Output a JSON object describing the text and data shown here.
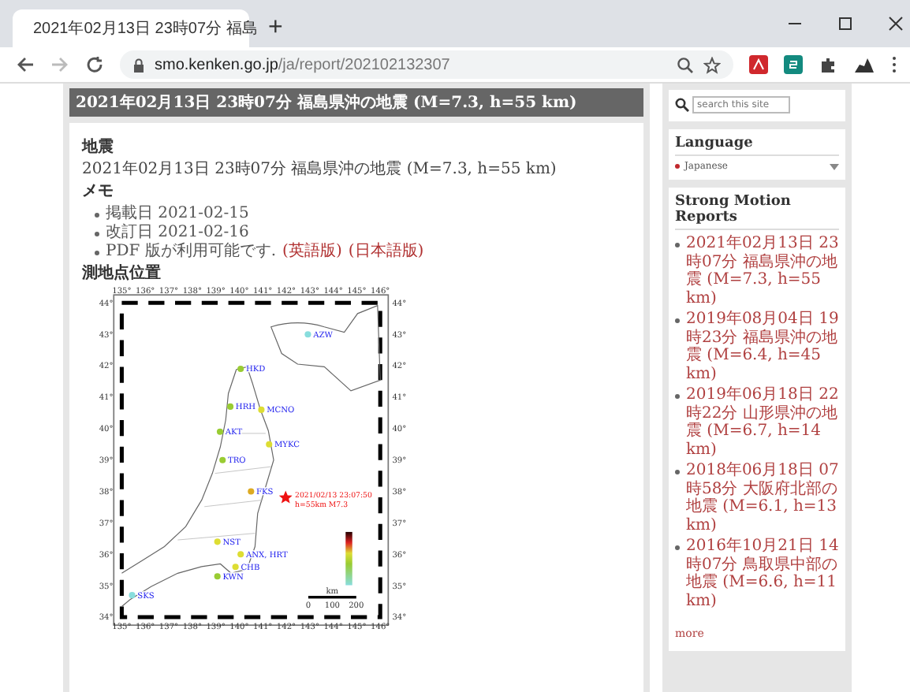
{
  "browser": {
    "tab_title": "2021年02月13日 23時07分 福島",
    "new_tab": "+",
    "url_host": "smo.kenken.go.jp",
    "url_path": "/ja/report/202102132307"
  },
  "page": {
    "heading": "2021年02月13日 23時07分 福島県沖の地震 (M=7.3, h=55 km)",
    "sections": [
      {
        "title": "地震",
        "text": "2021年02月13日 23時07分 福島県沖の地震 (M=7.3, h=55 km)"
      },
      {
        "title": "メモ",
        "items": [
          {
            "text": "掲載日 2021-02-15"
          },
          {
            "text": "改訂日 2021-02-16"
          },
          {
            "text": "PDF 版が利用可能です.",
            "links": [
              "(英語版)",
              "(日本語版)"
            ]
          }
        ]
      },
      {
        "title": "測地点位置"
      }
    ],
    "map": {
      "lon_ticks": [
        "135°",
        "136°",
        "137°",
        "138°",
        "139°",
        "140°",
        "141°",
        "142°",
        "143°",
        "144°",
        "145°",
        "146°"
      ],
      "lat_ticks": [
        "44°",
        "43°",
        "42°",
        "41°",
        "40°",
        "39°",
        "38°",
        "37°",
        "36°",
        "35°",
        "34°"
      ],
      "lat_ticks_right": [
        "44°",
        "43°",
        "42°",
        "41°",
        "40°",
        "39°",
        "38°",
        "37°",
        "36°",
        "35°",
        "34°"
      ],
      "lon_ticks_bottom": [
        "135°",
        "136°",
        "137°",
        "138°",
        "139°",
        "140°",
        "141°",
        "142°",
        "143°",
        "144°",
        "145°",
        "146°"
      ],
      "stations": [
        {
          "code": "AZW",
          "color": "#88dddd"
        },
        {
          "code": "HKD",
          "color": "#99cc33"
        },
        {
          "code": "HRH",
          "color": "#99cc33"
        },
        {
          "code": "MCNO",
          "color": "#dddd33"
        },
        {
          "code": "AKT",
          "color": "#99cc33"
        },
        {
          "code": "MYKC",
          "color": "#dddd33"
        },
        {
          "code": "TRO",
          "color": "#99cc33"
        },
        {
          "code": "FKS",
          "color": "#ddaa22"
        },
        {
          "code": "NST",
          "color": "#dddd33"
        },
        {
          "code": "ANX, HRT",
          "color": "#dddd33"
        },
        {
          "code": "CHB",
          "color": "#dddd33"
        },
        {
          "code": "KWN",
          "color": "#99cc33"
        },
        {
          "code": "SKS",
          "color": "#88dddd"
        }
      ],
      "epicenter": {
        "time": "2021/02/13 23:07:50",
        "depth": "h=55km M7.3"
      },
      "scale": {
        "unit": "km",
        "labels": [
          "0",
          "100",
          "200"
        ]
      }
    }
  },
  "sidebar": {
    "search": {
      "placeholder": "search this site"
    },
    "language": {
      "title": "Language",
      "value": "Japanese"
    },
    "reports": {
      "title": "Strong Motion Reports",
      "items": [
        "2021年02月13日 23時07分 福島県沖の地震 (M=7.3, h=55 km)",
        "2019年08月04日 19時23分 福島県沖の地震 (M=6.4, h=45 km)",
        "2019年06月18日 22時22分 山形県沖の地震 (M=6.7, h=14 km)",
        "2018年06月18日 07時58分 大阪府北部の地震 (M=6.1, h=13 km)",
        "2016年10月21日 14時07分 鳥取県中部の地震 (M=6.6, h=11 km)"
      ],
      "more": "more"
    }
  }
}
